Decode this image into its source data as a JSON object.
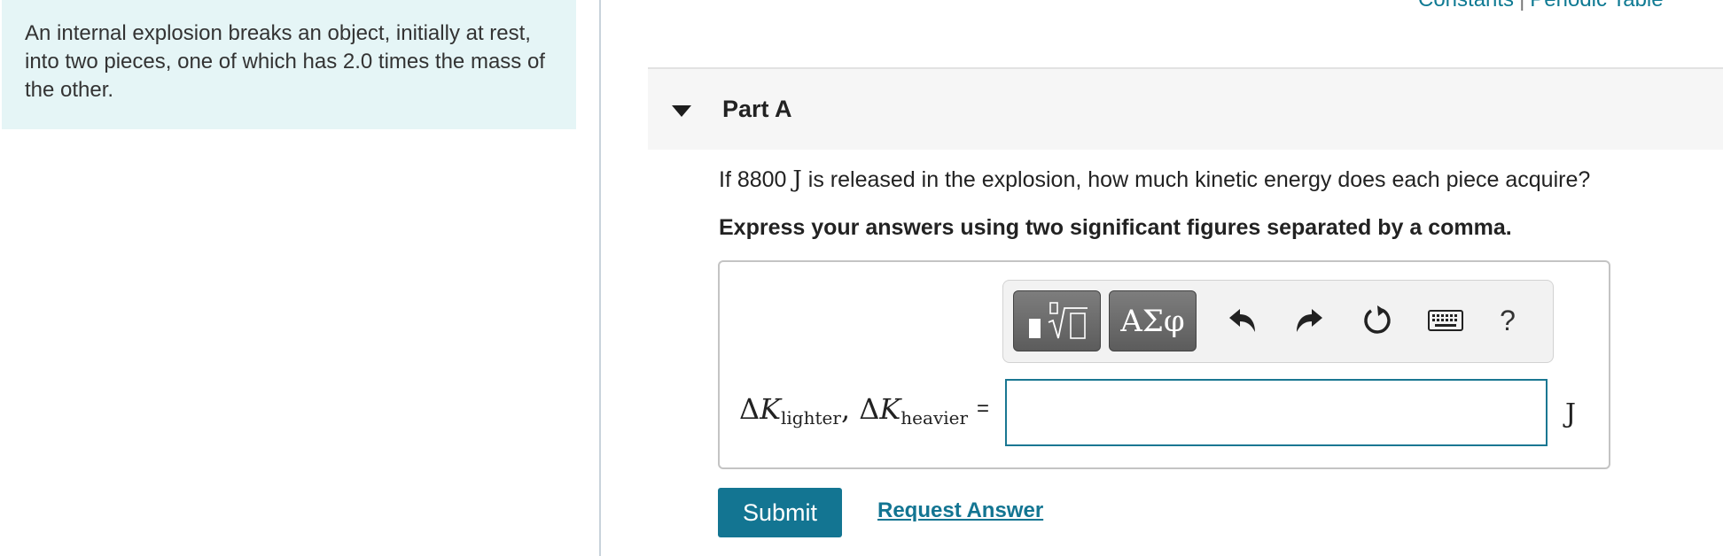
{
  "intro": {
    "text": "An internal explosion breaks an object, initially at rest, into two pieces, one of which has 2.0 times the mass of the other."
  },
  "top_links": {
    "constants": "Constants",
    "separator": "|",
    "periodic_table": "Periodic Table"
  },
  "part": {
    "title": "Part A"
  },
  "question": {
    "prefix": "If 8800 ",
    "unit": "J",
    "suffix": " is released in the explosion, how much kinetic energy does each piece acquire?",
    "instruction": "Express your answers using two significant figures separated by a comma."
  },
  "toolbar": {
    "greek_label": "ΑΣφ",
    "help_label": "?",
    "icons": [
      "templates-icon",
      "undo-icon",
      "redo-icon",
      "reset-icon",
      "keyboard-icon",
      "help-icon"
    ]
  },
  "formula": {
    "delta": "Δ",
    "var": "K",
    "sub1": "lighter",
    "comma": ", ",
    "sub2": "heavier",
    "equals": "="
  },
  "answer": {
    "value": "",
    "placeholder": "",
    "unit": "J"
  },
  "actions": {
    "submit_label": "Submit",
    "request_label": "Request Answer"
  },
  "colors": {
    "accent": "#137592",
    "intro_background": "#e5f5f6",
    "header_background": "#f6f6f6"
  }
}
